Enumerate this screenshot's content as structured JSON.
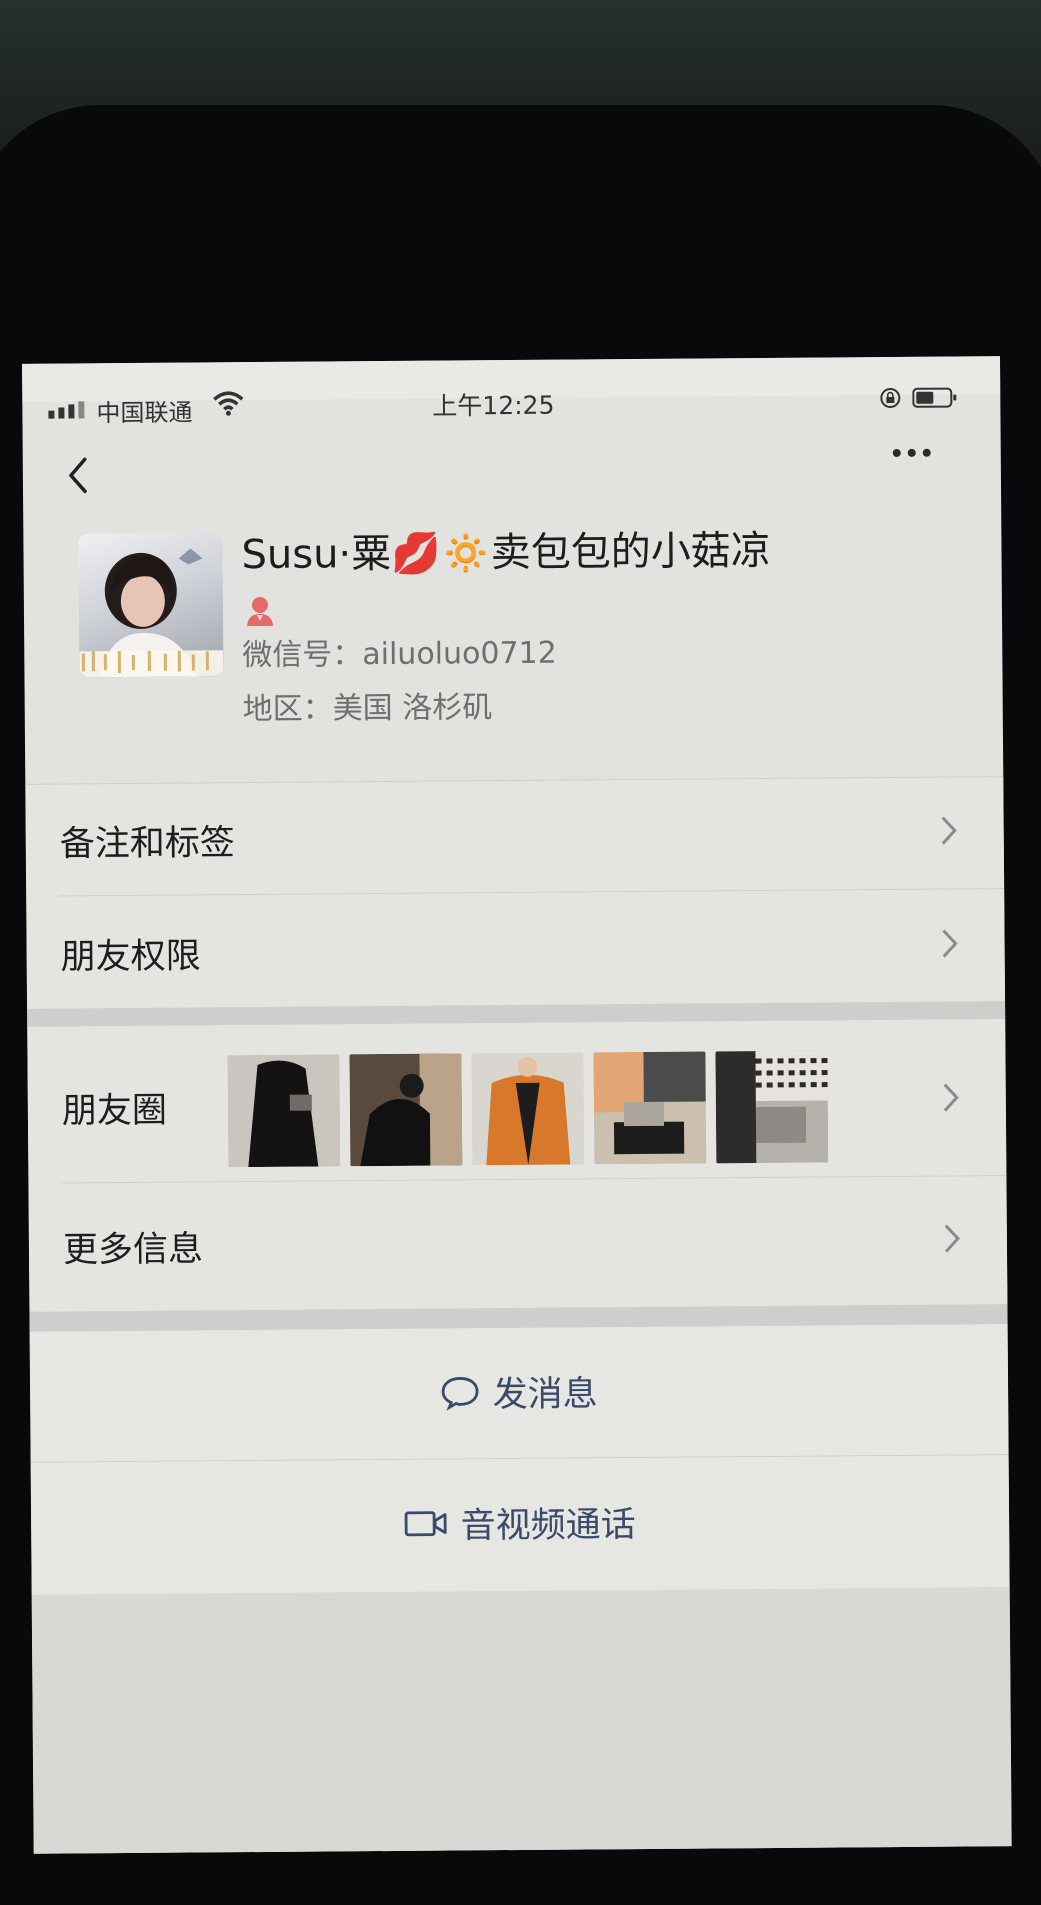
{
  "status_bar": {
    "carrier": "中国联通",
    "time": "上午12:25"
  },
  "profile": {
    "nickname": "Susu·粟💋🔅卖包包的小菇凉",
    "wechat_id": "微信号：ailuoluo0712",
    "region": "地区：美国 洛杉矶"
  },
  "rows": {
    "remarks_tags": "备注和标签",
    "friend_permissions": "朋友权限",
    "moments": "朋友圈",
    "more_info": "更多信息"
  },
  "actions": {
    "send_message": "发消息",
    "video_call": "音视频通话"
  },
  "colors": {
    "screen_bg": "#e2e2df",
    "action_text": "#3b4a6b",
    "gender_icon": "#e56b6b"
  },
  "icons": [
    "back-icon",
    "more-icon",
    "gender-female-icon",
    "chevron-right-icon",
    "chat-bubble-icon",
    "video-camera-icon"
  ]
}
